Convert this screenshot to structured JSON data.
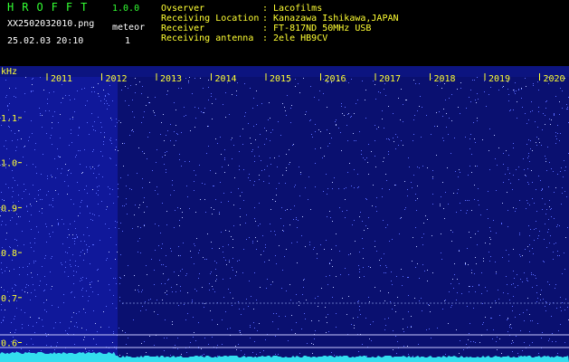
{
  "header": {
    "app_title": "HROFFT",
    "version": "1.0.0",
    "file_name": "XX2502032010.png",
    "meteor_label": "meteor",
    "timestamp": "25.02.03 20:10",
    "meteor_count": "1",
    "info_labels": "Ovserver\nReceiving Location\nReceiver\nReceiving antenna",
    "info_values": ": Lacofilms\n: Kanazawa Ishikawa,JAPAN\n: FT-817ND 50MHz USB\n: 2ele HB9CV"
  },
  "axis": {
    "y_unit": "kHz",
    "y_ticks": [
      "1.1",
      "1.0",
      "0.9",
      "0.8",
      "0.7",
      "0.6"
    ],
    "y_values": [
      1.1,
      1.0,
      0.9,
      0.8,
      0.7,
      0.6
    ],
    "x_ticks": [
      "2011",
      "2012",
      "2013",
      "2014",
      "2015",
      "2016",
      "2017",
      "2018",
      "2019",
      "2020"
    ]
  },
  "colors": {
    "background": "#000000",
    "text_yellow": "#ffff33",
    "text_green": "#33ff33",
    "text_white": "#ffffff",
    "noise_base": "#10189a",
    "noise_dark": "#0a1070",
    "baseline": "#33ddee"
  }
}
